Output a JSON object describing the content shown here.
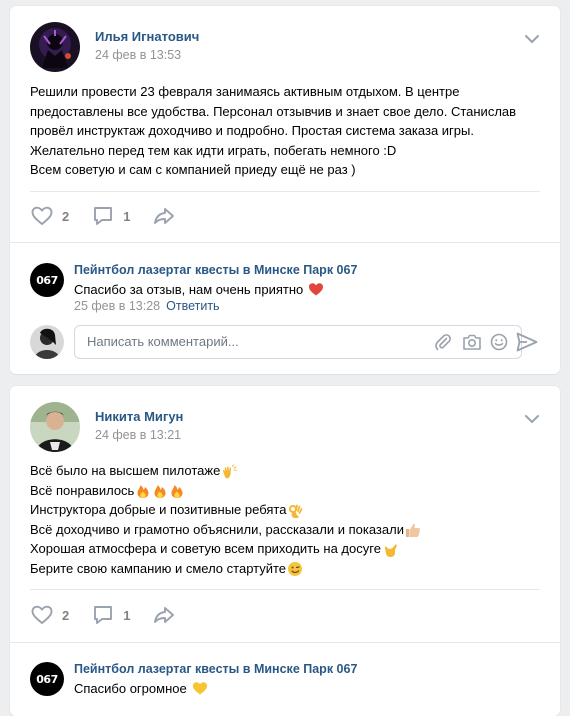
{
  "posts": [
    {
      "author": "Илья Игнатович",
      "date": "24 фев в 13:53",
      "lines": [
        "Решили провести 23 февраля занимаясь активным отдыхом. В центре",
        "предоставлены все удобства. Персонал отзывчив и знает свое дело. Станислав",
        "провёл инструктаж доходчиво и подробно. Простая система заказа игры.",
        "Желательно перед тем как идти играть, побегать немного :D",
        "Всем советую и сам с компанией приеду ещё не раз )"
      ],
      "likes": "2",
      "comments": "1",
      "reply": {
        "avatar_text": "067",
        "author": "Пейнтбол лазертаг квесты в Минске Парк 067",
        "text": "Спасибо за отзыв, нам очень приятно",
        "emoji": "red-heart-icon",
        "date": "25 фев в 13:28",
        "reply_link": "Ответить"
      },
      "composer": {
        "placeholder": "Написать комментарий..."
      }
    },
    {
      "author": "Никита Мигун",
      "date": "24 фев в 13:21",
      "lines": [
        {
          "text": "Всё было на высшем пилотаже",
          "emojis": [
            "clapping-hands-icon"
          ]
        },
        {
          "text": "Всё понравилось",
          "emojis": [
            "fire-icon",
            "fire-icon",
            "fire-icon"
          ]
        },
        {
          "text": "Инструктора добрые и позитивные ребята",
          "emojis": [
            "ok-hand-icon"
          ]
        },
        {
          "text": "Всё доходчиво и грамотно объяснили, рассказали и показали",
          "emojis": [
            "thumbs-up-icon"
          ]
        },
        {
          "text": "Хорошая атмосфера и советую всем приходить на досуге",
          "emojis": [
            "call-me-hand-icon"
          ]
        },
        {
          "text": "Берите свою кампанию и смело стартуйте",
          "emojis": [
            "winking-face-icon"
          ]
        }
      ],
      "likes": "2",
      "comments": "1",
      "reply": {
        "avatar_text": "067",
        "author": "Пейнтбол лазертаг квесты в Минске Парк 067",
        "text": "Спасибо огромное",
        "emoji": "yellow-heart-icon"
      }
    }
  ],
  "colors": {
    "link": "#2a5885",
    "meta": "#939393",
    "icon": "#99a2ad",
    "background": "#edeef0"
  }
}
